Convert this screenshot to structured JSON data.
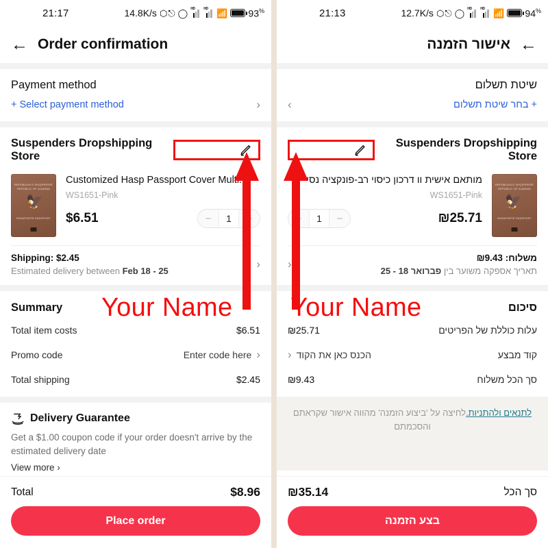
{
  "annotation": {
    "label_left": "Your Name",
    "label_right": "Your Name",
    "color": "#f60c0c"
  },
  "theme": {
    "accent": "#f5344b",
    "link": "#2a5fd6",
    "terms_link": "#1f7a8c",
    "divider": "#ece3d6"
  },
  "left": {
    "status": {
      "time": "21:17",
      "speed": "14.8K/s",
      "bluetooth_icon": "bluetooth-icon",
      "vpn_icon": "vpn-icon",
      "signal1_label": "HD",
      "signal2_label": "HD",
      "wifi_icon": "wifi-icon",
      "battery_icon": "battery-icon",
      "battery": "93",
      "battery_unit": "%"
    },
    "header": {
      "back_icon": "back-arrow-icon",
      "title": "Order confirmation"
    },
    "payment": {
      "title": "Payment method",
      "select_link": "+ Select payment method",
      "chevron": "›"
    },
    "store": {
      "name": "Suspenders Dropshipping Store",
      "edit_icon": "pencil-edit-icon"
    },
    "product": {
      "image_alt": "passport-cover-thumbnail",
      "image_top_text": "REPUBLIKA E SHQIPËRISË\nREPUBLIC OF ALBANIA",
      "image_bottom_text": "PASAPORTË\nPASSPORT",
      "name": "Customized Hasp Passport Cover Multi...",
      "sku": "WS1651-Pink",
      "price": "$6.51",
      "qty": "1",
      "minus": "−",
      "plus": "+"
    },
    "shipping": {
      "main": "Shipping: $2.45",
      "sub_prefix": "Estimated delivery between ",
      "sub_dates": "Feb 18 - 25",
      "chevron": "›"
    },
    "summary": {
      "title": "Summary",
      "rows": [
        {
          "label": "Total item costs",
          "value": "$6.51",
          "chevron": ""
        },
        {
          "label": "Promo code",
          "value": "Enter code here",
          "chevron": "›"
        },
        {
          "label": "Total shipping",
          "value": "$2.45",
          "chevron": ""
        }
      ]
    },
    "guarantee": {
      "icon": "delivery-guarantee-icon",
      "title": "Delivery Guarantee",
      "body": "Get a $1.00 coupon code if your order doesn't arrive by the estimated delivery date",
      "more": "View more ›"
    },
    "footer": {
      "total_label": "Total",
      "total_value": "$8.96",
      "cta": "Place order"
    }
  },
  "right": {
    "status": {
      "time": "21:13",
      "speed": "12.7K/s",
      "bluetooth_icon": "bluetooth-icon",
      "vpn_icon": "vpn-icon",
      "signal1_label": "HD",
      "signal2_label": "HD",
      "wifi_icon": "wifi-icon",
      "battery_icon": "battery-icon",
      "battery": "94",
      "battery_unit": "%"
    },
    "header": {
      "back_icon": "back-arrow-icon",
      "title": "אישור הזמנה"
    },
    "payment": {
      "title": "שיטת תשלום",
      "select_link": "+ בחר שיטת תשלום",
      "chevron": "›"
    },
    "store": {
      "name": "Suspenders Dropshipping Store",
      "edit_icon": "pencil-edit-icon"
    },
    "product": {
      "image_alt": "passport-cover-thumbnail",
      "image_top_text": "REPUBLIKA E SHQIPËRISË\nREPUBLIC OF ALBANIA",
      "image_bottom_text": "PASAPORTË\nPASSPORT",
      "name": "מותאם אישית וו דרכון כיסוי רב-פונקציה נסי",
      "sku": "WS1651-Pink",
      "price": "₪25.71",
      "qty": "1",
      "minus": "−",
      "plus": "+"
    },
    "shipping": {
      "main": "משלוח: ₪9.43",
      "sub_prefix": "תאריך אספקה משוער בין ",
      "sub_dates": "פברואר 18 - 25",
      "chevron": "›"
    },
    "summary": {
      "title": "סיכום",
      "rows": [
        {
          "label": "עלות כוללת של הפריטים",
          "value": "₪25.71",
          "chevron": ""
        },
        {
          "label": "קוד מבצע",
          "value": "הכנס כאן את הקוד",
          "chevron": "›"
        },
        {
          "label": "סך הכל משלוח",
          "value": "₪9.43",
          "chevron": ""
        }
      ]
    },
    "terms": {
      "text_before": "לחיצה על 'ביצוע הזמנה' מהווה אישור שקראתם והסכמתם",
      "link": "לתנאים ולהתניות."
    },
    "footer": {
      "total_label": "סך הכל",
      "total_value": "₪35.14",
      "cta": "בצע הזמנה"
    }
  }
}
